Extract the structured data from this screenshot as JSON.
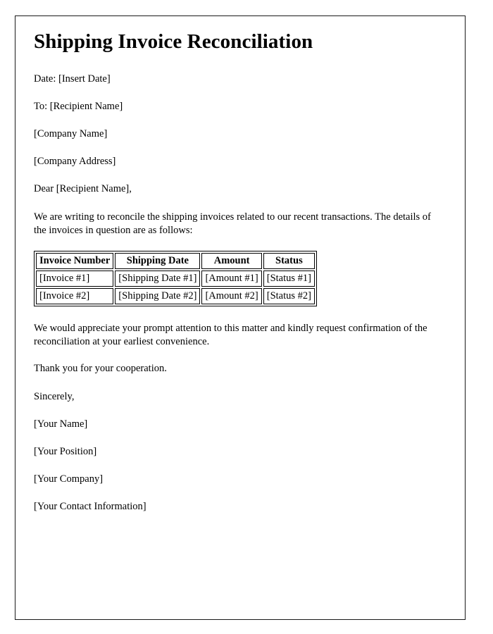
{
  "document": {
    "title": "Shipping Invoice Reconciliation",
    "header_lines": [
      "Date: [Insert Date]",
      "To: [Recipient Name]",
      "[Company Name]",
      "[Company Address]"
    ],
    "salutation": "Dear [Recipient Name],",
    "intro_paragraph": "We are writing to reconcile the shipping invoices related to our recent transactions. The details of the invoices in question are as follows:",
    "table": {
      "headers": [
        "Invoice Number",
        "Shipping Date",
        "Amount",
        "Status"
      ],
      "rows": [
        [
          "[Invoice #1]",
          "[Shipping Date #1]",
          "[Amount #1]",
          "[Status #1]"
        ],
        [
          "[Invoice #2]",
          "[Shipping Date #2]",
          "[Amount #2]",
          "[Status #2]"
        ]
      ]
    },
    "closing_paragraph": "We would appreciate your prompt attention to this matter and kindly request confirmation of the reconciliation at your earliest convenience.",
    "thanks_line": "Thank you for your cooperation.",
    "sign_off": "Sincerely,",
    "signature_lines": [
      "[Your Name]",
      "[Your Position]",
      "[Your Company]",
      "[Your Contact Information]"
    ]
  },
  "colors": {
    "page_background": "#ffffff",
    "text": "#000000",
    "page_border": "#1a1a1a",
    "table_border": "#000000"
  }
}
